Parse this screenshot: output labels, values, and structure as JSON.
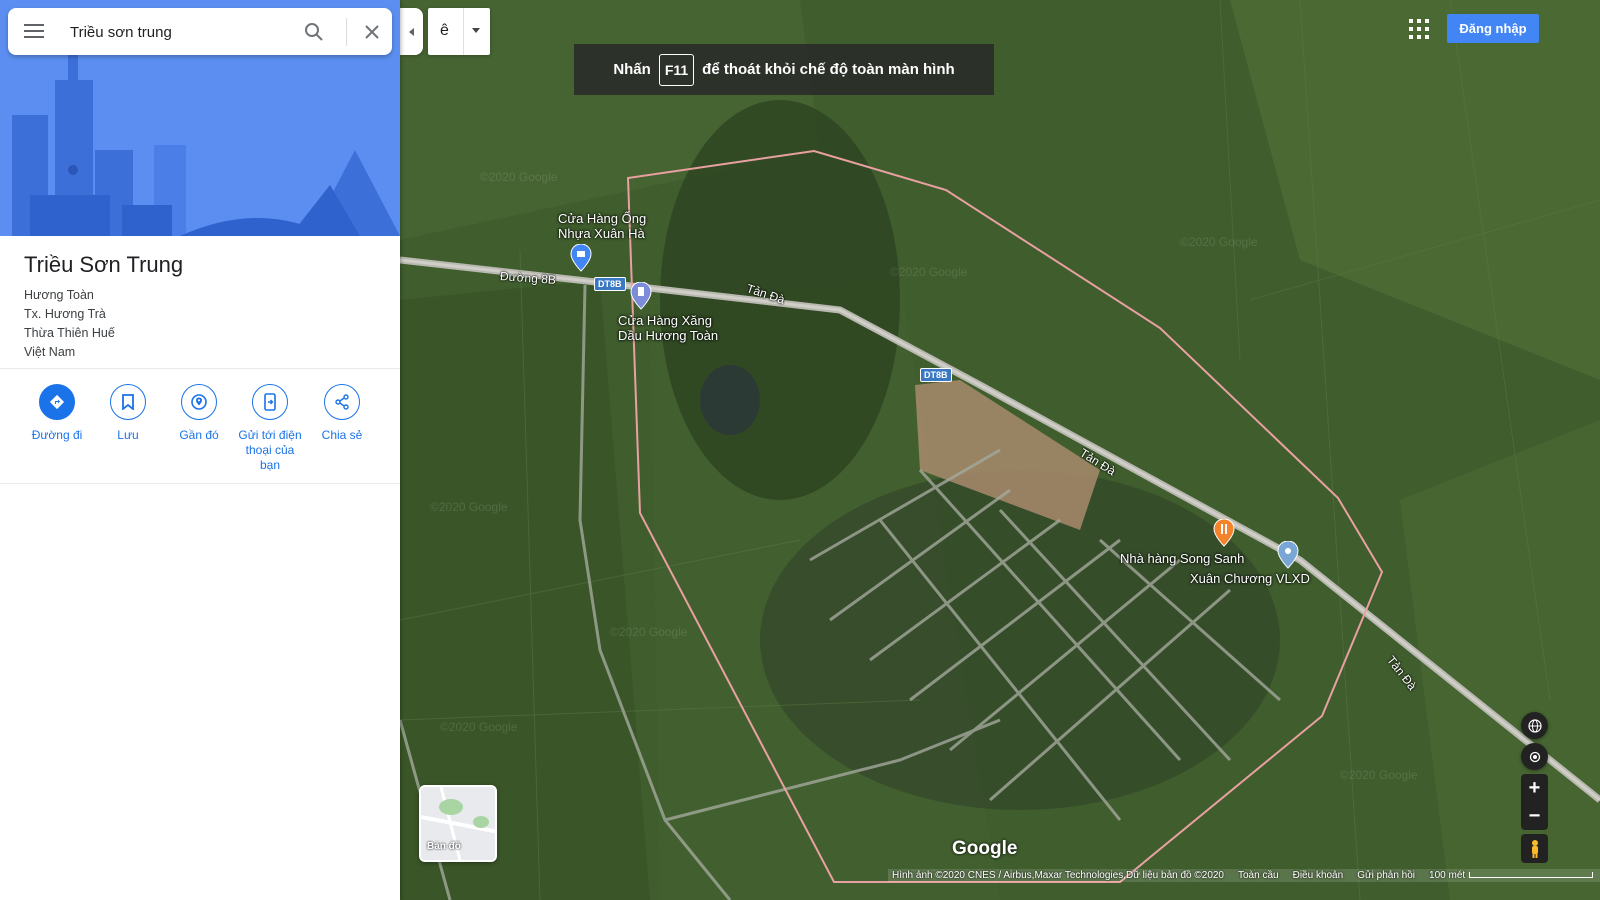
{
  "search": {
    "value": "Triều sơn trung"
  },
  "place": {
    "title": "Triều Sơn Trung",
    "address": [
      "Hương Toàn",
      "Tx. Hương Trà",
      "Thừa Thiên Huế",
      "Việt Nam"
    ]
  },
  "actions": [
    {
      "label": "Đường đi",
      "icon": "directions-icon"
    },
    {
      "label": "Lưu",
      "icon": "bookmark-icon"
    },
    {
      "label": "Gần đó",
      "icon": "nearby-icon"
    },
    {
      "label": "Gửi tới điện thoại của bạn",
      "icon": "send-to-phone-icon"
    },
    {
      "label": "Chia sẻ",
      "icon": "share-icon"
    }
  ],
  "input_tool": {
    "char": "ê"
  },
  "fullscreen_banner": {
    "prefix": "Nhấn",
    "key": "F11",
    "suffix": "để thoát khỏi chế độ toàn màn hình"
  },
  "header": {
    "signin_label": "Đăng nhập"
  },
  "map": {
    "places": [
      {
        "name_line1": "Cửa Hàng Ống",
        "name_line2": "Nhựa Xuân Hà",
        "icon": "shopping-pin-icon"
      },
      {
        "name_line1": "Cửa Hàng Xăng",
        "name_line2": "Dầu Hương Toàn",
        "icon": "gas-station-pin-icon"
      },
      {
        "name_line1": "Nhà hàng Song Sanh",
        "icon": "restaurant-pin-icon",
        "color": "#f4842b"
      },
      {
        "name_line1": "Xuân Chương VLXD",
        "icon": "place-pin-icon"
      }
    ],
    "roads": [
      "Đường 8B",
      "Tản Đà",
      "Tản Đà",
      "Tản Đà"
    ],
    "route_shields": [
      "DT8B",
      "DT8B"
    ],
    "watermark": "©2020 Google",
    "logo": "Google",
    "boundary_color": "#e8a0a0"
  },
  "minimap": {
    "label": "Bản đồ"
  },
  "footer": {
    "attribution": "Hình ảnh ©2020 CNES / Airbus,Maxar Technologies,Dữ liệu bản đồ ©2020",
    "globe": "Toàn cầu",
    "terms": "Điều khoản",
    "feedback": "Gửi phản hồi",
    "scale": "100 mét"
  }
}
